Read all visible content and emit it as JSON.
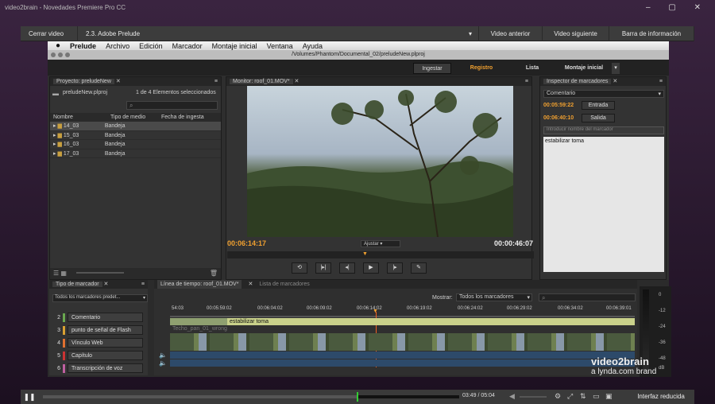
{
  "window": {
    "title": "video2brain - Novedades Premiere Pro CC"
  },
  "topbar": {
    "close": "Cerrar video",
    "chapter": "2.3. Adobe Prelude",
    "prev": "Video anterior",
    "next": "Video siguiente",
    "info": "Barra de información"
  },
  "menu": [
    "Prelude",
    "Archivo",
    "Edición",
    "Marcador",
    "Montaje inicial",
    "Ventana",
    "Ayuda"
  ],
  "app": {
    "path": "/Volumes/Phantom/Documental_02/preludeNew.plproj",
    "modes": {
      "ingest": "Ingestar",
      "log": "Registro",
      "list": "Lista",
      "rough": "Montaje inicial"
    }
  },
  "project": {
    "tab": "Proyecto: preludeNew",
    "file": "preludeNew.plproj",
    "selection": "1 de 4 Elementos seleccionados",
    "cols": [
      "Nombre",
      "Tipo de medio",
      "Fecha de ingesta"
    ],
    "rows": [
      {
        "name": "14_03",
        "type": "Bandeja"
      },
      {
        "name": "15_03",
        "type": "Bandeja"
      },
      {
        "name": "16_03",
        "type": "Bandeja"
      },
      {
        "name": "17_03",
        "type": "Bandeja"
      }
    ]
  },
  "monitor": {
    "tab": "Monitor: roof_01.MOV*",
    "current": "00:06:14:17",
    "duration": "00:00:46:07",
    "fit": "Ajustar"
  },
  "inspector": {
    "tab": "Inspector de marcadores",
    "type": "Comentario",
    "in_time": "00:05:59:22",
    "in_label": "Entrada",
    "out_time": "00:06:40:10",
    "out_label": "Salida",
    "name_placeholder": "Introducir nombre del marcador",
    "comment": "estabilizar toma"
  },
  "markers": {
    "tab": "Tipo de marcador",
    "filter": "Todos los marcadores predet...",
    "items": [
      {
        "n": "2",
        "label": "Comentario",
        "color": "#6aa84f"
      },
      {
        "n": "3",
        "label": "punto de señal de Flash",
        "color": "#d9a032"
      },
      {
        "n": "4",
        "label": "Vínculo Web",
        "color": "#e07030"
      },
      {
        "n": "5",
        "label": "Capítulo",
        "color": "#cc3333"
      },
      {
        "n": "6",
        "label": "Transcripción de voz",
        "color": "#c060a0"
      }
    ]
  },
  "timeline": {
    "tab": "Línea de tiempo: roof_01.MOV*",
    "tab2": "Lista de marcadores",
    "show_label": "Mostrar:",
    "show_value": "Todos los marcadores",
    "ticks": [
      "54:03",
      "00:05:59:02",
      "00:06:04:02",
      "00:06:09:02",
      "00:06:14:02",
      "00:06:19:02",
      "00:06:24:02",
      "00:06:29:02",
      "00:06:34:02",
      "00:06:39:01"
    ],
    "marker_label": "estabilizar toma",
    "clip": "Techo_pan_01_wrong"
  },
  "meter": [
    "0",
    "-12",
    "-24",
    "-36",
    "-48",
    "dB"
  ],
  "watermark": {
    "line1": "video2brain",
    "line2": "a lynda.com brand"
  },
  "player": {
    "time": "03:49 / 05:04",
    "progress": 0.753,
    "reduce": "Interfaz reducida"
  }
}
